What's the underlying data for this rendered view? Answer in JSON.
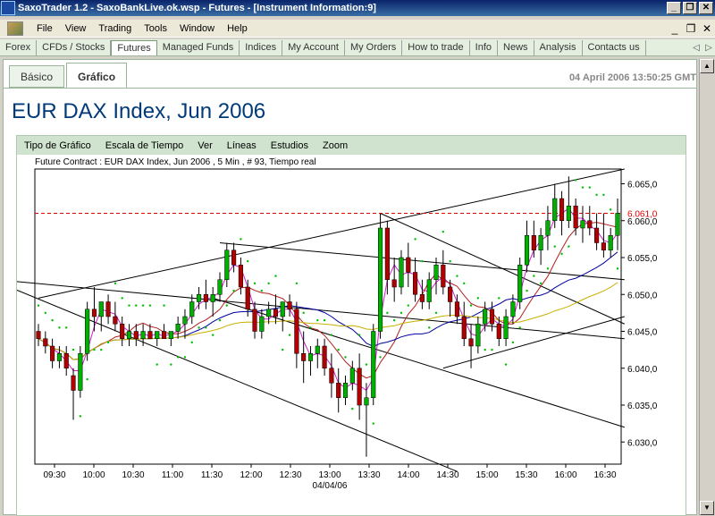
{
  "window": {
    "title": "SaxoTrader 1.2 - SaxoBankLive.ok.wsp - Futures - [Instrument Information:9]",
    "logo_text": "Saxo Bank",
    "buttons": [
      "_",
      "❐",
      "✕"
    ]
  },
  "menu": {
    "items": [
      "File",
      "View",
      "Trading",
      "Tools",
      "Window",
      "Help"
    ],
    "right_buttons": [
      "_",
      "❐",
      "✕"
    ]
  },
  "nav": {
    "tabs": [
      "Forex",
      "CFDs / Stocks",
      "Futures",
      "Managed Funds",
      "Indices",
      "My Account",
      "My Orders",
      "How to trade",
      "Info",
      "News",
      "Analysis",
      "Contacts us"
    ],
    "active": "Futures",
    "arrows": [
      "◁",
      "▷"
    ]
  },
  "subtabs": [
    "Básico",
    "Gráfico"
  ],
  "active_subtab": "Gráfico",
  "timestamp": "04 April 2006 13:50:25 GMT",
  "instrument_title": "EUR DAX Index, Jun 2006",
  "chart_menu": [
    "Tipo de Gráfico",
    "Escala de Tiempo",
    "Ver",
    "Líneas",
    "Estudios",
    "Zoom"
  ],
  "chart_data": {
    "type": "line",
    "title": "Future Contract : EUR DAX Index, Jun 2006 , 5 Min , # 93, Tiempo real",
    "x_ticks": [
      "09:30",
      "10:00",
      "10:30",
      "11:00",
      "11:30",
      "12:00",
      "12:30",
      "13:00",
      "13:30",
      "14:00",
      "14:30",
      "15:00",
      "15:30",
      "16:00",
      "16:30"
    ],
    "x_date": "04/04/06",
    "y_ticks": [
      "6.030,0",
      "6.035,0",
      "6.040,0",
      "6.045,0",
      "6.050,0",
      "6.055,0",
      "6.060,0",
      "6.065,0"
    ],
    "ylim": [
      6027,
      6067
    ],
    "current_price_label": "6.061,0",
    "current_price": 6061.0,
    "colors": {
      "up": "#00b000",
      "down": "#b00000",
      "current_price": "#e00000",
      "ma_fast": "#d020d0",
      "ma_mid": "#b02020",
      "ma_slow_blue": "#0000a0",
      "ma_slowest": "#c8b000",
      "sar": "#00c000",
      "trend": "#000000"
    },
    "candles": [
      [
        6045,
        6046,
        6043,
        6044
      ],
      [
        6044,
        6045,
        6042,
        6043
      ],
      [
        6043,
        6044,
        6040,
        6041
      ],
      [
        6041,
        6043,
        6040,
        6042
      ],
      [
        6042,
        6043,
        6039,
        6040
      ],
      [
        6039,
        6040,
        6033,
        6037
      ],
      [
        6037,
        6043,
        6036,
        6042
      ],
      [
        6042,
        6049,
        6041,
        6048
      ],
      [
        6048,
        6051,
        6045,
        6047
      ],
      [
        6047,
        6049,
        6045,
        6049
      ],
      [
        6049,
        6050,
        6046,
        6047
      ],
      [
        6047,
        6049,
        6045,
        6046
      ],
      [
        6046,
        6047,
        6043,
        6044
      ],
      [
        6044,
        6046,
        6043,
        6045
      ],
      [
        6045,
        6046,
        6043,
        6044
      ],
      [
        6044,
        6046,
        6043,
        6045
      ],
      [
        6045,
        6046,
        6044,
        6044
      ],
      [
        6044,
        6045,
        6043,
        6045
      ],
      [
        6045,
        6046,
        6044,
        6044
      ],
      [
        6044,
        6045,
        6043,
        6045
      ],
      [
        6045,
        6047,
        6044,
        6046
      ],
      [
        6046,
        6048,
        6044,
        6047
      ],
      [
        6047,
        6050,
        6046,
        6049
      ],
      [
        6049,
        6051,
        6048,
        6050
      ],
      [
        6050,
        6052,
        6048,
        6049
      ],
      [
        6049,
        6051,
        6047,
        6050
      ],
      [
        6050,
        6053,
        6049,
        6052
      ],
      [
        6052,
        6057,
        6051,
        6056
      ],
      [
        6056,
        6057,
        6053,
        6054
      ],
      [
        6054,
        6055,
        6050,
        6051
      ],
      [
        6051,
        6052,
        6047,
        6048
      ],
      [
        6048,
        6049,
        6044,
        6045
      ],
      [
        6045,
        6048,
        6044,
        6047
      ],
      [
        6047,
        6049,
        6046,
        6048
      ],
      [
        6048,
        6050,
        6046,
        6047
      ],
      [
        6047,
        6049,
        6045,
        6049
      ],
      [
        6049,
        6050,
        6047,
        6048
      ],
      [
        6048,
        6049,
        6040,
        6042
      ],
      [
        6042,
        6045,
        6038,
        6041
      ],
      [
        6041,
        6043,
        6039,
        6042
      ],
      [
        6042,
        6044,
        6040,
        6043
      ],
      [
        6043,
        6044,
        6039,
        6040
      ],
      [
        6040,
        6042,
        6036,
        6038
      ],
      [
        6038,
        6040,
        6034,
        6036
      ],
      [
        6036,
        6039,
        6035,
        6038
      ],
      [
        6038,
        6041,
        6037,
        6040
      ],
      [
        6040,
        6042,
        6033,
        6035
      ],
      [
        6035,
        6038,
        6028,
        6036
      ],
      [
        6036,
        6046,
        6035,
        6045
      ],
      [
        6045,
        6061,
        6044,
        6059
      ],
      [
        6059,
        6060,
        6050,
        6052
      ],
      [
        6052,
        6055,
        6049,
        6051
      ],
      [
        6051,
        6056,
        6050,
        6055
      ],
      [
        6055,
        6057,
        6051,
        6053
      ],
      [
        6053,
        6055,
        6049,
        6050
      ],
      [
        6050,
        6052,
        6048,
        6049
      ],
      [
        6049,
        6053,
        6048,
        6052
      ],
      [
        6052,
        6055,
        6050,
        6054
      ],
      [
        6054,
        6056,
        6050,
        6051
      ],
      [
        6051,
        6052,
        6047,
        6049
      ],
      [
        6049,
        6050,
        6046,
        6047
      ],
      [
        6047,
        6049,
        6043,
        6044
      ],
      [
        6044,
        6046,
        6040,
        6043
      ],
      [
        6043,
        6047,
        6042,
        6046
      ],
      [
        6046,
        6049,
        6045,
        6048
      ],
      [
        6048,
        6049,
        6045,
        6046
      ],
      [
        6046,
        6047,
        6043,
        6044
      ],
      [
        6044,
        6048,
        6043,
        6047
      ],
      [
        6047,
        6050,
        6046,
        6049
      ],
      [
        6049,
        6055,
        6048,
        6054
      ],
      [
        6054,
        6060,
        6053,
        6058
      ],
      [
        6058,
        6060,
        6055,
        6056
      ],
      [
        6056,
        6059,
        6054,
        6058
      ],
      [
        6058,
        6062,
        6056,
        6060
      ],
      [
        6060,
        6065,
        6059,
        6063
      ],
      [
        6063,
        6064,
        6058,
        6060
      ],
      [
        6060,
        6066,
        6059,
        6062
      ],
      [
        6062,
        6063,
        6058,
        6059
      ],
      [
        6059,
        6062,
        6057,
        6060
      ],
      [
        6060,
        6062,
        6058,
        6059
      ],
      [
        6059,
        6061,
        6056,
        6057
      ],
      [
        6057,
        6061,
        6055,
        6056
      ],
      [
        6056,
        6059,
        6055,
        6058
      ],
      [
        6058,
        6063,
        6056,
        6061
      ]
    ]
  }
}
